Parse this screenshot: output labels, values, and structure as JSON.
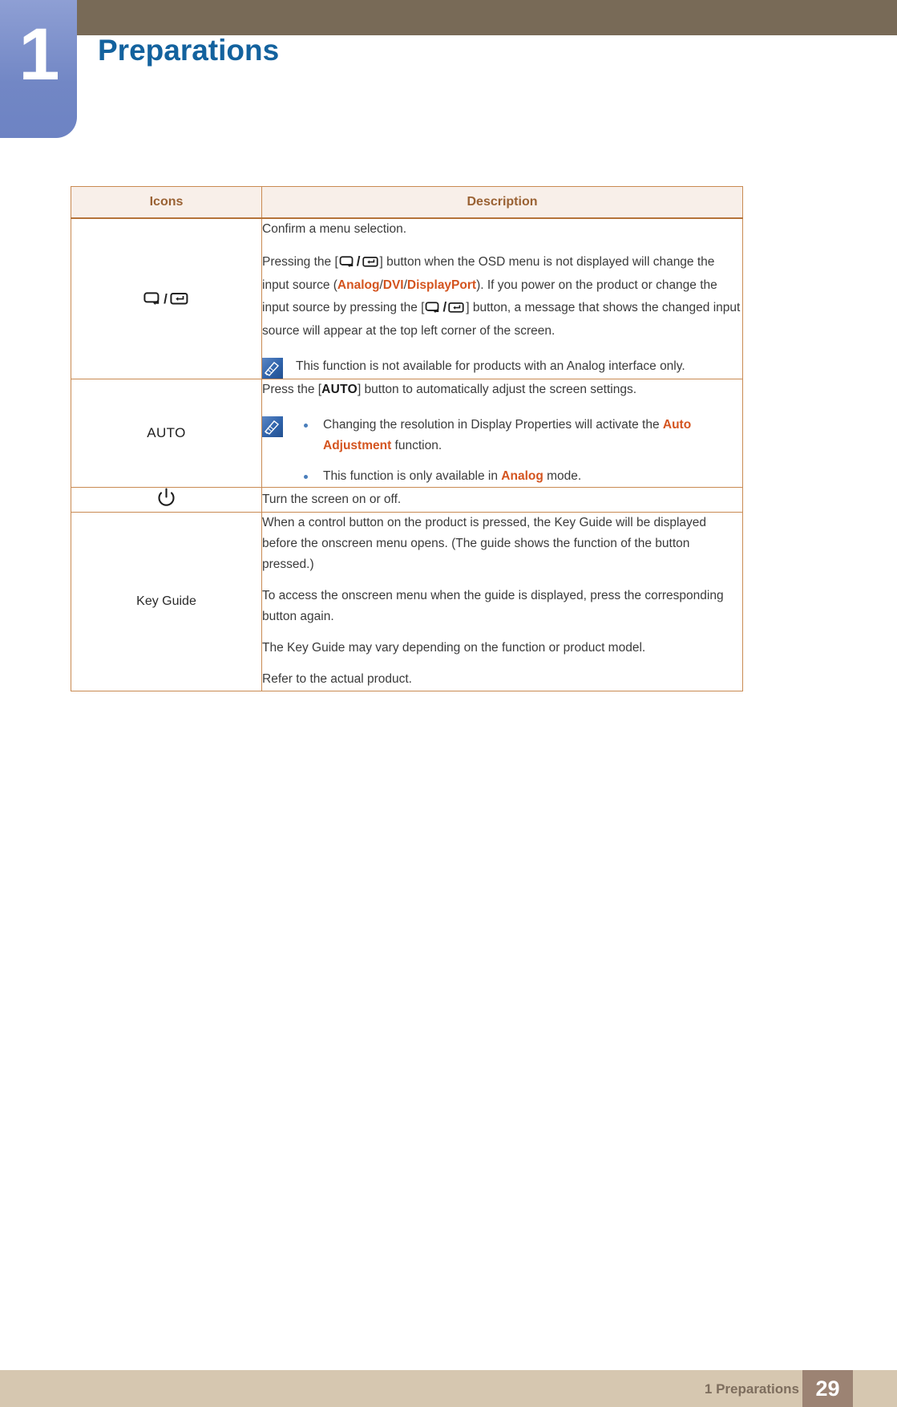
{
  "header": {
    "chapter_number": "1",
    "chapter_title": "Preparations"
  },
  "table": {
    "columns": [
      "Icons",
      "Description"
    ],
    "rows": [
      {
        "icon_name": "source-enter-icon",
        "icon_label": "",
        "paragraphs": [
          "Confirm a menu selection.",
          "Pressing the [",
          "] button when the OSD menu is not displayed will change the input source (",
          "). If you power on the product or change the input source by pressing the [",
          "] button, a message that shows the changed input source will appear at the top left corner of the screen."
        ],
        "highlights": [
          "Analog",
          "DVI",
          "DisplayPort"
        ],
        "note": "This function is not available for products with an Analog interface only."
      },
      {
        "icon_name": "auto-button-icon",
        "icon_label": "AUTO",
        "lead_prefix": "Press the [",
        "lead_key": "AUTO",
        "lead_suffix": "] button to automatically adjust the screen settings.",
        "bullets": [
          {
            "pre": "Changing the resolution in Display Properties will activate the ",
            "hl": "Auto Adjustment",
            "post": " function."
          },
          {
            "pre": "This function is only available in ",
            "hl": "Analog",
            "post": " mode."
          }
        ]
      },
      {
        "icon_name": "power-icon",
        "icon_label": "⏻",
        "text": "Turn the screen on or off."
      },
      {
        "icon_name": "key-guide-icon",
        "icon_label": "Key Guide",
        "paragraphs": [
          "When a control button on the product is pressed, the Key Guide will be displayed before the onscreen menu opens. (The guide shows the function of the button pressed.)",
          "To access the onscreen menu when the guide is displayed, press the corresponding button again.",
          "The Key Guide may vary depending on the function or product model.",
          "Refer to the actual product."
        ]
      }
    ]
  },
  "footer": {
    "text": "1 Preparations",
    "page": "29"
  },
  "colors": {
    "header_band": "#786a57",
    "chapter_tab": "#7287c5",
    "title_blue": "#13629e",
    "table_border": "#c98a52",
    "table_head_bg": "#f8efe9",
    "table_head_text": "#9a6234",
    "highlight_orange": "#d4541f",
    "bullet_blue": "#4a7ebb",
    "footer_band": "#d6c7b0",
    "footer_page_bg": "#9c8373"
  }
}
